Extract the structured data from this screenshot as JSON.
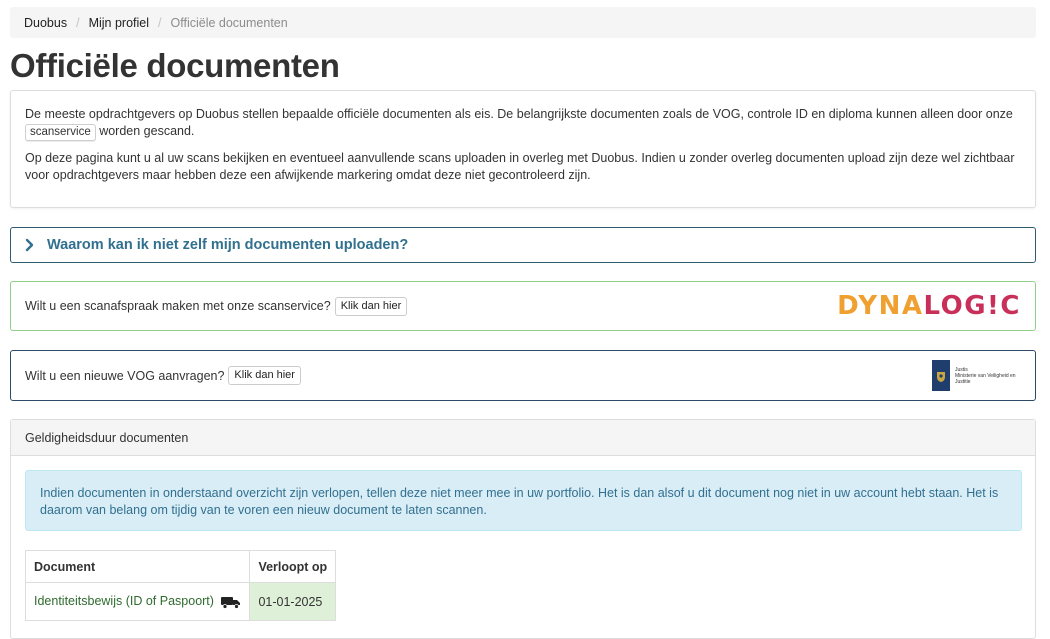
{
  "breadcrumb": {
    "home": "Duobus",
    "profile": "Mijn profiel",
    "current": "Officiële documenten"
  },
  "page_title": "Officiële documenten",
  "intro": {
    "p1_before": "De meeste opdrachtgevers op Duobus stellen bepaalde officiële documenten als eis. De belangrijkste documenten zoals de VOG, controle ID en diploma kunnen alleen door onze",
    "p1_badge": "scanservice",
    "p1_after": "worden gescand.",
    "p2": "Op deze pagina kunt u al uw scans bekijken en eventueel aanvullende scans uploaden in overleg met Duobus. Indien u zonder overleg documenten upload zijn deze wel zichtbaar voor opdrachtgevers maar hebben deze een afwijkende markering omdat deze niet gecontroleerd zijn."
  },
  "collapse": {
    "title": "Waarom kan ik niet zelf mijn documenten uploaden?",
    "icon": "chevron-right-icon"
  },
  "scan_panel": {
    "text": "Wilt u een scanafspraak maken met onze scanservice?",
    "button": "Klik dan hier",
    "logo_part1": "DYNA",
    "logo_part2": "LOG!C"
  },
  "vog_panel": {
    "text": "Wilt u een nieuwe VOG aanvragen?",
    "button": "Klik dan hier",
    "logo_line1": "Justis",
    "logo_line2": "Ministerie van Veiligheid en Justitie"
  },
  "validity": {
    "heading": "Geldigheidsduur documenten",
    "alert": "Indien documenten in onderstaand overzicht zijn verlopen, tellen deze niet meer mee in uw portfolio. Het is dan alsof u dit document nog niet in uw account hebt staan. Het is daarom van belang om tijdig van te voren een nieuw document te laten scannen.",
    "columns": [
      "Document",
      "Verloopt op"
    ],
    "rows": [
      {
        "document": "Identiteitsbewijs (ID of Paspoort)",
        "icon": "truck-icon",
        "expires": "01-01-2025"
      }
    ]
  },
  "colors": {
    "link_blue": "#31708f",
    "success_border": "#8fcf8a",
    "info_bg": "#d9edf7",
    "success_bg": "#dff0d8",
    "logo_orange": "#f0a030",
    "logo_pink": "#c8305a"
  }
}
